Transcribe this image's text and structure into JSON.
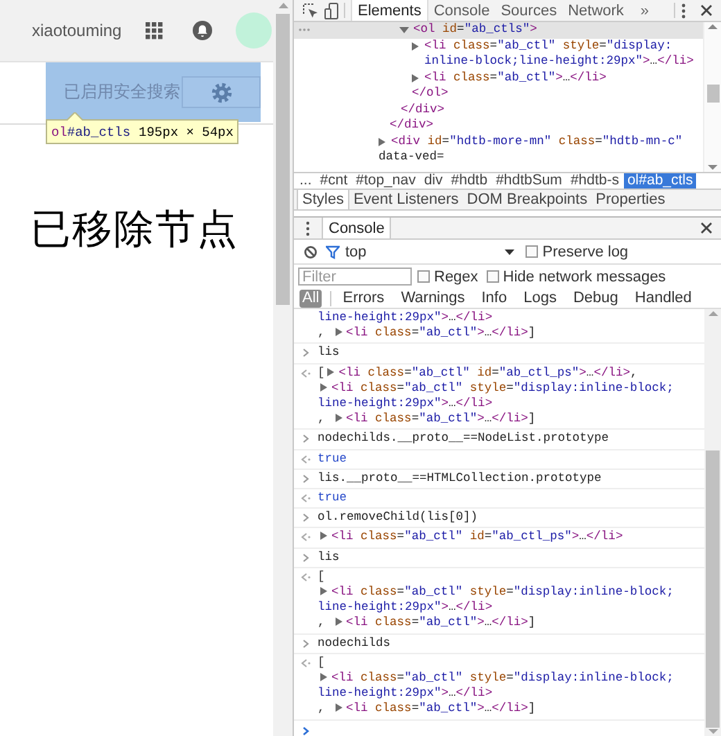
{
  "page": {
    "username": "xiaotouming",
    "highlight_label": "已启用安全搜索",
    "tooltip": {
      "selector": "ol#ab_ctls",
      "size": "195px × 54px"
    },
    "annotation": "已移除节点"
  },
  "devtools": {
    "tabs": [
      {
        "label": "Elements",
        "selected": true
      },
      {
        "label": "Console",
        "selected": false
      },
      {
        "label": "Sources",
        "selected": false
      },
      {
        "label": "Network",
        "selected": false
      }
    ],
    "more_tabs": "»",
    "dom_tree": [
      {
        "children": [
          {
            "children": [
              {
                "open": "<ol id=\"ab_ctls\">",
                "expanded": true,
                "selected": true,
                "children": [
                  {
                    "open": "<li class=\"ab_ctl\" style=\"display: inline-block;line-height:29px\">…</li>",
                    "expanded": false,
                    "selected": false
                  },
                  {
                    "open": "<li class=\"ab_ctl\">…</li>",
                    "expanded": false,
                    "selected": false
                  }
                ],
                "close": "</ol>"
              }
            ],
            "close": "</div>"
          }
        ],
        "close": "</div>"
      },
      {
        "open_lines": [
          "<div id=\"hdtb-more-mn\" class=\"hdtb-mn-c\"",
          "data-ved="
        ],
        "expanded": false,
        "selected": false
      }
    ],
    "breadcrumbs_overflow": "...",
    "breadcrumbs": [
      {
        "label": "#cnt",
        "selected": false
      },
      {
        "label": "#top_nav",
        "selected": false
      },
      {
        "label": "div",
        "selected": false
      },
      {
        "label": "#hdtb",
        "selected": false
      },
      {
        "label": "#hdtbSum",
        "selected": false
      },
      {
        "label": "#hdtb-s",
        "selected": false
      },
      {
        "label": "ol#ab_ctls",
        "selected": true
      }
    ],
    "sidebar_tabs": [
      {
        "label": "Styles",
        "selected": true
      },
      {
        "label": "Event Listeners",
        "selected": false
      },
      {
        "label": "DOM Breakpoints",
        "selected": false
      },
      {
        "label": "Properties",
        "selected": false
      }
    ],
    "console": {
      "tabs": [
        {
          "label": "Console",
          "selected": true
        }
      ],
      "context": "top",
      "preserve_log": {
        "label": "Preserve log",
        "checked": false
      },
      "filter": {
        "placeholder": "Filter"
      },
      "regex": {
        "label": "Regex",
        "checked": false
      },
      "hide_network": {
        "label": "Hide network messages",
        "checked": false
      },
      "levels": [
        {
          "label": "All",
          "selected": true
        },
        {
          "label": "Errors",
          "selected": false
        },
        {
          "label": "Warnings",
          "selected": false
        },
        {
          "label": "Info",
          "selected": false
        },
        {
          "label": "Logs",
          "selected": false
        },
        {
          "label": "Debug",
          "selected": false
        },
        {
          "label": "Handled",
          "selected": false
        }
      ],
      "messages": [
        {
          "kind": "continuation",
          "lines": [
            {
              "text": "line-height:29px\">…</li>",
              "starts_in_value": true
            },
            {
              "lead": ", ",
              "arrow": true,
              "text": "<li class=\"ab_ctl\">…</li>]"
            }
          ]
        },
        {
          "kind": "input",
          "lines": [
            {
              "text": "lis"
            }
          ]
        },
        {
          "kind": "element",
          "lines": [
            {
              "lead": "[",
              "arrow": true,
              "text": "<li class=\"ab_ctl\" id=\"ab_ctl_ps\">…</li>,"
            },
            {
              "arrow": true,
              "text": "<li class=\"ab_ctl\" style=\"display:inline-block;"
            },
            {
              "text": "line-height:29px\">…</li>",
              "starts_in_value": true
            },
            {
              "lead": ", ",
              "arrow": true,
              "text": "<li class=\"ab_ctl\">…</li>]"
            }
          ]
        },
        {
          "kind": "input",
          "lines": [
            {
              "text": "nodechilds.__proto__==NodeList.prototype"
            }
          ]
        },
        {
          "kind": "boolean",
          "lines": [
            {
              "text": "true"
            }
          ]
        },
        {
          "kind": "input",
          "lines": [
            {
              "text": "lis.__proto__==HTMLCollection.prototype"
            }
          ]
        },
        {
          "kind": "boolean",
          "lines": [
            {
              "text": "true"
            }
          ]
        },
        {
          "kind": "input",
          "lines": [
            {
              "text": "ol.removeChild(lis[0])"
            }
          ]
        },
        {
          "kind": "element",
          "lines": [
            {
              "arrow": true,
              "text": "<li class=\"ab_ctl\" id=\"ab_ctl_ps\">…</li>"
            }
          ]
        },
        {
          "kind": "input",
          "lines": [
            {
              "text": "lis"
            }
          ]
        },
        {
          "kind": "element",
          "lines": [
            {
              "lead": "["
            },
            {
              "arrow": true,
              "text": "<li class=\"ab_ctl\" style=\"display:inline-block;"
            },
            {
              "text": "line-height:29px\">…</li>",
              "starts_in_value": true
            },
            {
              "lead": ", ",
              "arrow": true,
              "text": "<li class=\"ab_ctl\">…</li>]"
            }
          ]
        },
        {
          "kind": "input",
          "lines": [
            {
              "text": "nodechilds"
            }
          ]
        },
        {
          "kind": "element",
          "lines": [
            {
              "lead": "["
            },
            {
              "arrow": true,
              "text": "<li class=\"ab_ctl\" style=\"display:inline-block;"
            },
            {
              "text": "line-height:29px\">…</li>",
              "starts_in_value": true
            },
            {
              "lead": ", ",
              "arrow": true,
              "text": "<li class=\"ab_ctl\">…</li>]"
            }
          ]
        }
      ]
    }
  }
}
